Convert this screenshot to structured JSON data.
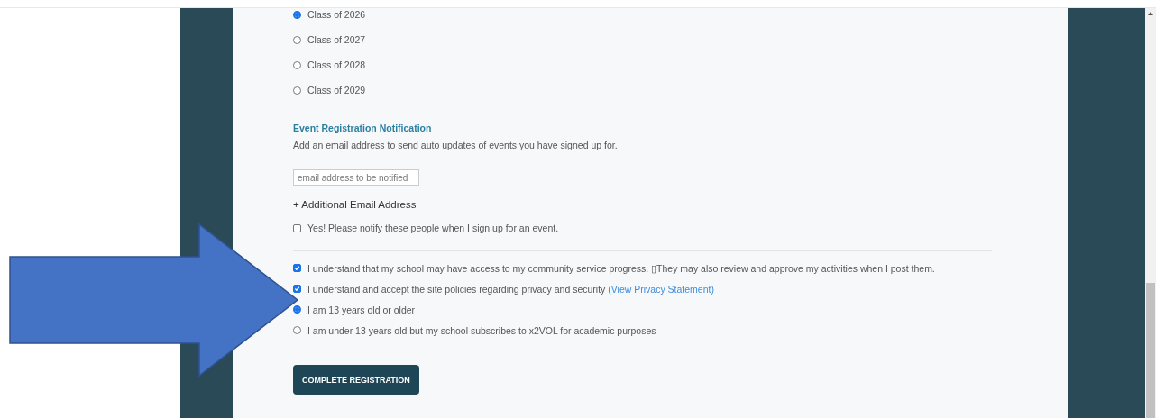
{
  "class_options": [
    {
      "label": "Class of 2026",
      "selected": true
    },
    {
      "label": "Class of 2027",
      "selected": false
    },
    {
      "label": "Class of 2028",
      "selected": false
    },
    {
      "label": "Class of 2029",
      "selected": false
    }
  ],
  "notification": {
    "heading": "Event Registration Notification",
    "description": "Add an email address to send auto updates of events you have signed up for.",
    "email_placeholder": "email address to be notified",
    "add_link": "+ Additional Email Address",
    "notify_checkbox": {
      "label": "Yes! Please notify these people when I sign up for an event.",
      "checked": false
    }
  },
  "agreements": [
    {
      "label": "I understand that my school may have access to my community service progress. ▯They may also review and approve my activities when I post them.",
      "checked": true
    },
    {
      "label": "I understand and accept the site policies regarding privacy and security",
      "link": "(View Privacy Statement)",
      "checked": true
    }
  ],
  "age_options": [
    {
      "label": "I am 13 years old or older",
      "selected": true
    },
    {
      "label": "I am under 13 years old but my school subscribes to x2VOL for academic purposes",
      "selected": false
    }
  ],
  "submit_button": "COMPLETE REGISTRATION"
}
